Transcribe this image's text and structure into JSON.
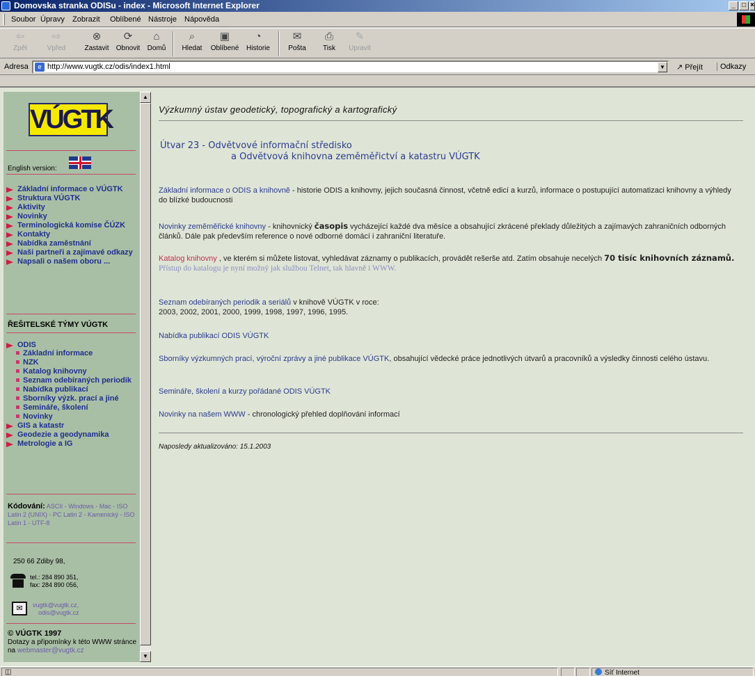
{
  "window": {
    "title": "Domovska stranka ODISu - index - Microsoft Internet Explorer",
    "minimize": "_",
    "maximize": "□",
    "close": "×"
  },
  "menu": [
    "Soubor",
    "Úpravy",
    "Zobrazit",
    "Oblíbené",
    "Nástroje",
    "Nápověda"
  ],
  "toolbar": {
    "back": "Zpět",
    "forward": "Vpřed",
    "stop": "Zastavit",
    "refresh": "Obnovit",
    "home": "Domů",
    "search": "Hledat",
    "favorites": "Oblíbené",
    "history": "Historie",
    "mail": "Pošta",
    "print": "Tisk",
    "edit": "Upravit"
  },
  "address": {
    "label": "Adresa",
    "url": "http://www.vugtk.cz/odis/index1.html",
    "go": "Přejít",
    "links": "Odkazy"
  },
  "sidebar": {
    "logo_text": "VÚGTK",
    "english_version": "English version:",
    "nav": [
      "Základní informace o VÚGTK",
      "Struktura VÚGTK",
      "Aktivity",
      "Novinky",
      "Terminologická komise ČÚZK",
      "Kontakty",
      "Nabídka zaměstnání",
      "Naši partneři a zajímavé odkazy",
      "Napsali o našem oboru ..."
    ],
    "teams_title": "ŘEŠITELSKÉ TÝMY VÚGTK",
    "odis": "ODIS",
    "odis_sub": [
      "Základní informace",
      "NZK",
      "Katalog knihovny",
      "Seznam odebíraných periodik",
      "Nabídka publikací",
      "Sborníky výzk. prací a jiné",
      "Semináře, školení",
      "Novinky"
    ],
    "teams_more": [
      "GIS a katastr",
      "Geodezie a geodynamika",
      "Metrologie a IG"
    ],
    "encoding_label": "Kódování:",
    "encodings": "ASCII - Windows - Mac - ISO Latin 2 (UNIX) - PC Latin 2 - Kamenický - ISO Latin 1 - UTF-8",
    "address_line": "250 66 Zdiby 98,",
    "tel": "tel.: 284 890 351,",
    "fax": "fax: 284 890 056,",
    "email1": "vugtk@vugtk.cz,",
    "email2": "odis@vugtk.cz",
    "copyright": "© VÚGTK 1997",
    "copy_note": "Dotazy a připomínky k této WWW stránce na",
    "webmaster": "webmaster@vugtk.cz"
  },
  "main": {
    "institute": "Výzkumný ústav geodetický, topografický a kartografický",
    "utvar_line1": "Útvar 23 -  Odvětvové informační středisko",
    "utvar_line2": "a Odvětvová knihovna zeměměřictví a katastru VÚGTK",
    "p1_link": "Základní informace o ODIS a knihovně",
    "p1_text": " - historie ODIS a knihovny, jejich současná činnost, včetně edicí a kurzů, informace o postupující automatizaci knihovny a výhledy do blízké budoucnosti",
    "p2_link": "Novinky zeměměřické knihovny",
    "p2_text_a": " - knihovnický ",
    "p2_bold": "časopis",
    "p2_text_b": " vycházející každé dva měsíce a obsahující zkrácené překlady důležitých a zajímavých zahraničních odborných článků. Dále pak především reference o nové odborné domácí i zahraniční literatuře.",
    "p3_link": "Katalog knihovny",
    "p3_text": " , ve kterém si můžete listovat, vyhledávat záznamy o publikacích, provádět rešerše atd. Zatím obsahuje necelých ",
    "p3_bold": "70 tisíc knihovních záznamů.",
    "p3_gray": "Přístup do katalogu je nyní možný jak službou Telnet, tak hlavně i WWW.",
    "p4_link": "Seznam odebíraných periodik a seriálů",
    "p4_text": " v knihově VÚGTK v roce:",
    "p4_years": "2003, 2002, 2001, 2000, 1999, 1998, 1997, 1996, 1995.",
    "p5_link": "Nabídka publikací ODIS VÚGTK",
    "p6_link": "Sborníky výzkumných prací, výroční zprávy a jiné publikace VÚGTK",
    "p6_text": ", obsahující vědecké práce jednotlivých útvarů a pracovníků a výsledky činnosti celého ústavu.",
    "p7_link": "Semináře, školení a kurzy pořádané ODIS VÚGTK",
    "p8_link": "Novinky na našem WWW",
    "p8_text": " - chronologický přehled doplňování informací",
    "updated": "Naposledy aktualizováno: 15.1.2003"
  },
  "status": {
    "left": "",
    "zone": "Síť Internet"
  }
}
